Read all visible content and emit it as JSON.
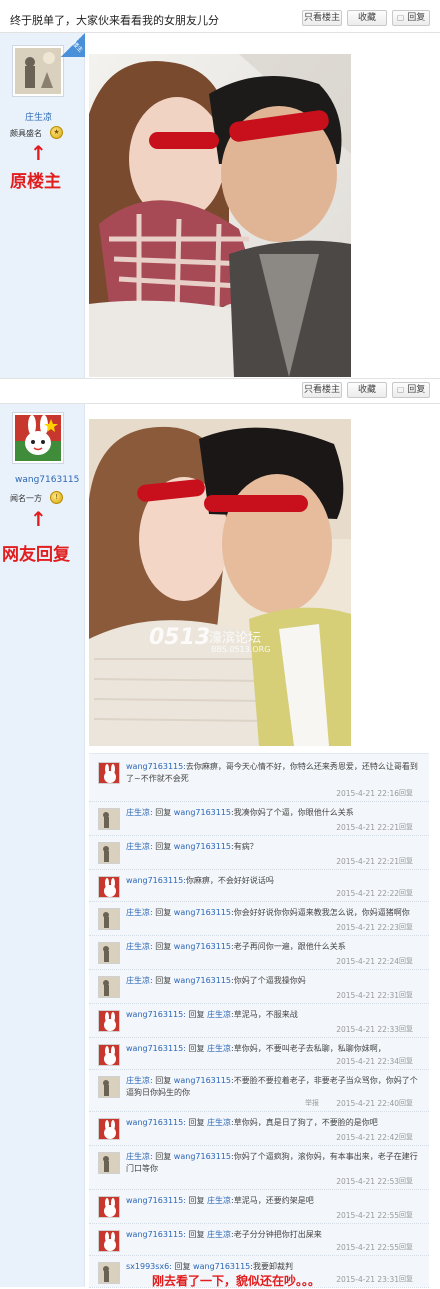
{
  "post1": {
    "title": "终于脱单了，大家伙来看看我的女朋友儿分",
    "buttons": {
      "only_op": "只看楼主",
      "favorite": "收藏",
      "reply": "回复"
    },
    "author": {
      "name": "庄生凉",
      "rank": "颇具盛名",
      "badge": "楼主"
    },
    "annotation": "原楼主"
  },
  "post2": {
    "buttons": {
      "only_op": "只看楼主",
      "favorite": "收藏",
      "reply": "回复"
    },
    "author": {
      "name": "wang7163115",
      "rank": "闻名一方"
    },
    "annotation": "网友回复",
    "watermark": {
      "logo": "0513",
      "site_name": "濠滨论坛",
      "url": "BBS.0513.ORG"
    }
  },
  "comments": [
    {
      "user": "wang7163115:",
      "text": "去你麻痹，哥今天心情不好，你特么还来秀恩爱，还特么让哥看到了~不作就不会死",
      "date": "2015-4-21 22:16",
      "action": "回复"
    },
    {
      "user": "庄生凉:",
      "reply_word": "回复",
      "reply_to": "wang7163115",
      "text": ":我凑你妈了个逼，你眼他什么关系",
      "date": "2015-4-21 22:21",
      "action": "回复"
    },
    {
      "user": "庄生凉:",
      "reply_word": "回复",
      "reply_to": "wang7163115",
      "text": ":有病？",
      "date": "2015-4-21 22:21",
      "action": "回复"
    },
    {
      "user": "wang7163115:",
      "text": "你麻痹，不会好好说话吗",
      "date": "2015-4-21 22:22",
      "action": "回复"
    },
    {
      "user": "庄生凉:",
      "reply_word": "回复",
      "reply_to": "wang7163115",
      "text": ":你会好好说你你妈逼来教我怎么说，你妈逼猪啊你",
      "date": "2015-4-21 22:23",
      "action": "回复"
    },
    {
      "user": "庄生凉:",
      "reply_word": "回复",
      "reply_to": "wang7163115",
      "text": ":老子再问你一遍，跟他什么关系",
      "date": "2015-4-21 22:24",
      "action": "回复"
    },
    {
      "user": "庄生凉:",
      "reply_word": "回复",
      "reply_to": "wang7163115",
      "text": ":你妈了个逼我操你妈",
      "date": "2015-4-21 22:31",
      "action": "回复"
    },
    {
      "user": "wang7163115:",
      "reply_word": "回复",
      "reply_to": "庄生凉",
      "text": ":草泥马，不服来战",
      "date": "2015-4-21 22:33",
      "action": "回复"
    },
    {
      "user": "wang7163115:",
      "reply_word": "回复",
      "reply_to": "庄生凉",
      "text": ":草你妈，不要叫老子去私聊，私聊你妹啊，",
      "date": "2015-4-21 22:34",
      "action": "回复"
    },
    {
      "user": "庄生凉:",
      "reply_word": "回复",
      "reply_to": "wang7163115",
      "text": ":不要脸不要拉着老子，非要老子当众骂你，你妈了个逼狗日你妈生的你",
      "date": "2015-4-21 22:40",
      "action": "回复",
      "jump": "举报"
    },
    {
      "user": "wang7163115:",
      "reply_word": "回复",
      "reply_to": "庄生凉",
      "text": ":草你妈，真是日了狗了，不要脸的是你吧",
      "date": "2015-4-21 22:42",
      "action": "回复"
    },
    {
      "user": "庄生凉:",
      "reply_word": "回复",
      "reply_to": "wang7163115",
      "text": ":你妈了个逼疯狗，滚你妈，有本事出来，老子在建行门口等你",
      "date": "2015-4-21 22:53",
      "action": "回复"
    },
    {
      "user": "wang7163115:",
      "reply_word": "回复",
      "reply_to": "庄生凉",
      "text": ":草泥马，还要约架是吧",
      "date": "2015-4-21 22:55",
      "action": "回复"
    },
    {
      "user": "wang7163115:",
      "reply_word": "回复",
      "reply_to": "庄生凉",
      "text": ":老子分分钟把你打出屎来",
      "date": "2015-4-21 22:55",
      "action": "回复"
    },
    {
      "user": "sx1993sx6:",
      "reply_word": "回复",
      "reply_to": "wang7163115",
      "text": ":我要卸裁判",
      "date": "2015-4-21 23:31",
      "action": "回复"
    }
  ],
  "bottom_annotation": "刚去看了一下，貌似还在吵。。。",
  "colors": {
    "annotation_red": "#e11d1d",
    "censor_red": "#c8101c",
    "link_blue": "#2b67b7",
    "sidebar_bg": "#e9f2fb"
  }
}
